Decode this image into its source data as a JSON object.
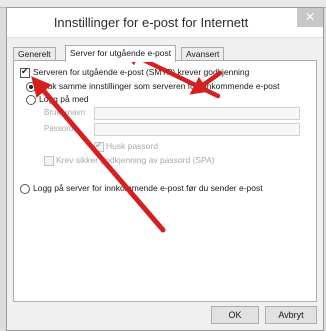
{
  "dialog": {
    "title": "Innstillinger for e-post for Internett",
    "close_glyph": "✕"
  },
  "tabs": [
    {
      "label": "Generelt",
      "active": false
    },
    {
      "label": "Server for utgående e-post",
      "active": true
    },
    {
      "label": "Avansert",
      "active": false
    }
  ],
  "panel": {
    "requires_auth_label": "Serveren for utgående e-post (SMTP) krever godkjenning",
    "requires_auth_checked": true,
    "use_same_settings_label": "Bruk samme innstillinger som serveren for innkommende e-post",
    "use_same_settings_selected": true,
    "log_on_with_label": "Logg på med",
    "log_on_with_selected": false,
    "username_label": "Brukernavn:",
    "username_value": "",
    "password_label": "Passord:",
    "password_value": "",
    "remember_password_label": "Husk passord",
    "remember_password_checked": true,
    "spa_label": "Krev sikker godkjenning av passord (SPA)",
    "spa_checked": false,
    "log_on_incoming_first_label": "Logg på server for innkommende e-post før du sender e-post",
    "log_on_incoming_first_selected": false
  },
  "buttons": {
    "ok_label": "OK",
    "cancel_label": "Avbryt"
  },
  "annotation": {
    "arrow_color": "#d61f1f"
  }
}
